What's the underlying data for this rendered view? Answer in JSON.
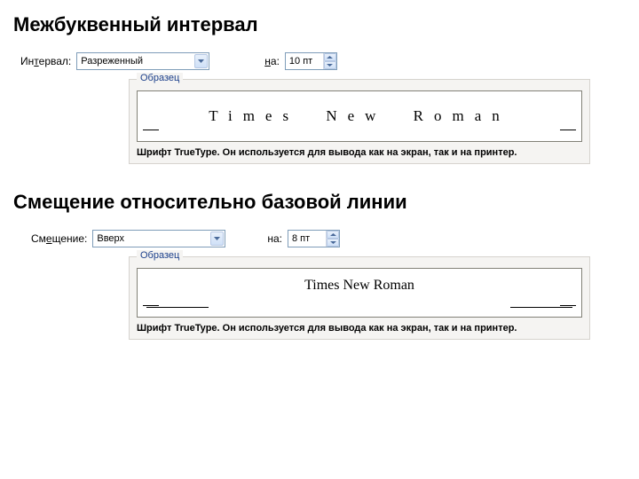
{
  "section1": {
    "title": "Межбуквенный интервал",
    "interval_label_pre": "Ин",
    "interval_label_hot": "т",
    "interval_label_post": "ервал:",
    "interval_value": "Разреженный",
    "on_label_hot": "н",
    "on_label_post": "а:",
    "on_value": "10 пт",
    "preview_label": "Образец",
    "sample_text": "Times New Roman",
    "hint": "Шрифт TrueType. Он используется для вывода как на экран, так и на принтер."
  },
  "section2": {
    "title": "Смещение относительно базовой линии",
    "shift_label_pre": "См",
    "shift_label_hot": "е",
    "shift_label_post": "щение:",
    "shift_value": "Вверх",
    "on_label": "на:",
    "on_value": "8 пт",
    "preview_label": "Образец",
    "sample_text": "Times New Roman",
    "hint": "Шрифт TrueType. Он используется для вывода как на экран, так и на принтер."
  }
}
